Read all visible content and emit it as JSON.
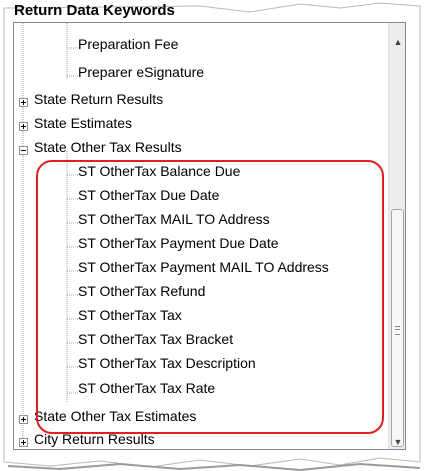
{
  "panel_title": "Return Data Keywords",
  "tree": {
    "items": [
      {
        "label": "Preparation Fee",
        "level": "child",
        "expander": "none"
      },
      {
        "label": "Preparer eSignature",
        "level": "child",
        "expander": "none"
      },
      {
        "label": "State Return Results",
        "level": "top",
        "expander": "collapsed"
      },
      {
        "label": "State Estimates",
        "level": "top",
        "expander": "collapsed"
      },
      {
        "label": "State Other Tax Results",
        "level": "top",
        "expander": "expanded"
      },
      {
        "label": "ST OtherTax Balance Due",
        "level": "child",
        "expander": "none"
      },
      {
        "label": "ST OtherTax Due Date",
        "level": "child",
        "expander": "none"
      },
      {
        "label": "ST OtherTax MAIL TO Address",
        "level": "child",
        "expander": "none"
      },
      {
        "label": "ST OtherTax Payment Due Date",
        "level": "child",
        "expander": "none"
      },
      {
        "label": "ST OtherTax Payment MAIL TO Address",
        "level": "child",
        "expander": "none"
      },
      {
        "label": "ST OtherTax Refund",
        "level": "child",
        "expander": "none"
      },
      {
        "label": "ST OtherTax Tax",
        "level": "child",
        "expander": "none"
      },
      {
        "label": "ST OtherTax Tax Bracket",
        "level": "child",
        "expander": "none"
      },
      {
        "label": "ST OtherTax Tax Description",
        "level": "child",
        "expander": "none"
      },
      {
        "label": "ST OtherTax Tax Rate",
        "level": "child",
        "expander": "none"
      },
      {
        "label": "State Other Tax Estimates",
        "level": "top",
        "expander": "collapsed"
      },
      {
        "label": "City Return Results",
        "level": "top",
        "expander": "collapsed"
      }
    ]
  },
  "scrollbar": {
    "up_icon": "triangle-up-icon",
    "down_icon": "triangle-down-icon"
  },
  "colors": {
    "highlight": "#e02020",
    "border": "#7d8a99",
    "tree_line": "#a0a0a0"
  }
}
